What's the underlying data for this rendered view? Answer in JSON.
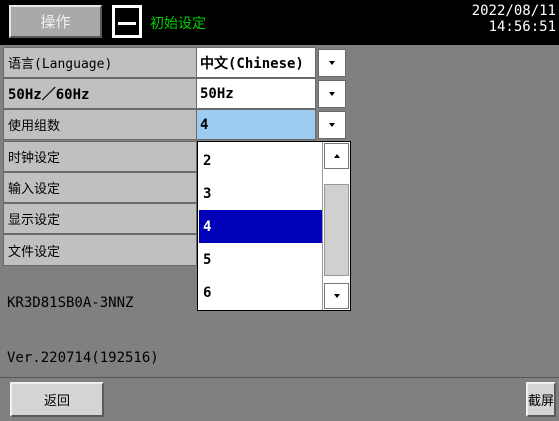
{
  "header": {
    "operate_button": "操作",
    "title": "初始设定",
    "date": "2022/08/11",
    "time": "14:56:51"
  },
  "settings": [
    {
      "label": "语言(Language)",
      "value": "中文(Chinese)"
    },
    {
      "label": "50Hz／60Hz",
      "value": "50Hz"
    },
    {
      "label": "使用组数",
      "value": "4"
    }
  ],
  "menu_items": [
    "时钟设定",
    "输入设定",
    "显示设定",
    "文件设定"
  ],
  "dropdown": {
    "options": [
      "2",
      "3",
      "4",
      "5",
      "6"
    ],
    "selected": "4"
  },
  "model": "KR3D81SB0A-3NNZ",
  "version": "Ver.220714(192516)",
  "footer": {
    "back_button": "返回",
    "screenshot_button": "截屏"
  },
  "colors": {
    "header_bg": "#000000",
    "title_green": "#00d000",
    "selection_blue": "#0000b8",
    "selected_field": "#9ecbf0",
    "panel_gray": "#808080"
  }
}
